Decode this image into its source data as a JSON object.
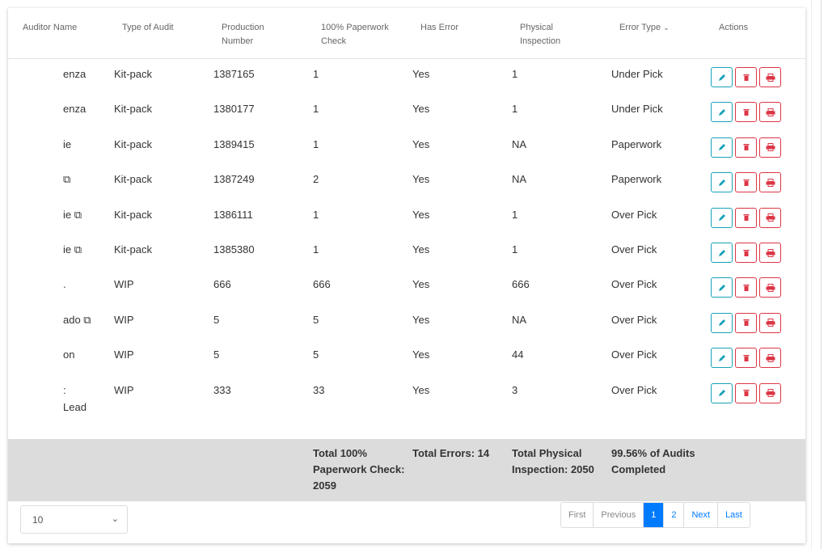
{
  "headers": {
    "auditor": "Auditor Name",
    "type": "Type of Audit",
    "production": "Production Number",
    "paperwork": "100% Paperwork Check",
    "has_error": "Has Error",
    "physical": "Physical Inspection",
    "error_type": "Error Type",
    "actions": "Actions"
  },
  "rows": [
    {
      "auditor": "enza",
      "type": "Kit-pack",
      "production": "1387165",
      "paperwork": "1",
      "has_error": "Yes",
      "physical": "1",
      "error_type": "Under Pick"
    },
    {
      "auditor": "enza",
      "type": "Kit-pack",
      "production": "1380177",
      "paperwork": "1",
      "has_error": "Yes",
      "physical": "1",
      "error_type": "Under Pick"
    },
    {
      "auditor": "ie",
      "type": "Kit-pack",
      "production": "1389415",
      "paperwork": "1",
      "has_error": "Yes",
      "physical": "NA",
      "error_type": "Paperwork"
    },
    {
      "auditor": "⧉",
      "type": "Kit-pack",
      "production": "1387249",
      "paperwork": "2",
      "has_error": "Yes",
      "physical": "NA",
      "error_type": "Paperwork"
    },
    {
      "auditor": "ie ⧉",
      "type": "Kit-pack",
      "production": "1386111",
      "paperwork": "1",
      "has_error": "Yes",
      "physical": "1",
      "error_type": "Over Pick"
    },
    {
      "auditor": "ie ⧉",
      "type": "Kit-pack",
      "production": "1385380",
      "paperwork": "1",
      "has_error": "Yes",
      "physical": "1",
      "error_type": "Over Pick"
    },
    {
      "auditor": ".",
      "type": "WIP",
      "production": "666",
      "paperwork": "666",
      "has_error": "Yes",
      "physical": "666",
      "error_type": "Over Pick"
    },
    {
      "auditor": "ado ⧉",
      "type": "WIP",
      "production": "5",
      "paperwork": "5",
      "has_error": "Yes",
      "physical": "NA",
      "error_type": "Over Pick"
    },
    {
      "auditor": "on",
      "type": "WIP",
      "production": "5",
      "paperwork": "5",
      "has_error": "Yes",
      "physical": "44",
      "error_type": "Over Pick"
    },
    {
      "auditor": ":",
      "auditor2": "Lead",
      "type": "WIP",
      "production": "333",
      "paperwork": "33",
      "has_error": "Yes",
      "physical": "3",
      "error_type": "Over Pick"
    }
  ],
  "footer": {
    "paperwork": "Total 100% Paperwork Check: 2059",
    "errors": "Total Errors: 14",
    "physical": "Total Physical Inspection: 2050",
    "completed": "99.56% of Audits Completed"
  },
  "page_size": "10",
  "pagination": {
    "first": "First",
    "previous": "Previous",
    "pages": [
      "1",
      "2"
    ],
    "current": "1",
    "next": "Next",
    "last": "Last"
  },
  "colors": {
    "edit": "#17a2b8",
    "delete": "#dc3545",
    "active_page": "#007bff"
  }
}
